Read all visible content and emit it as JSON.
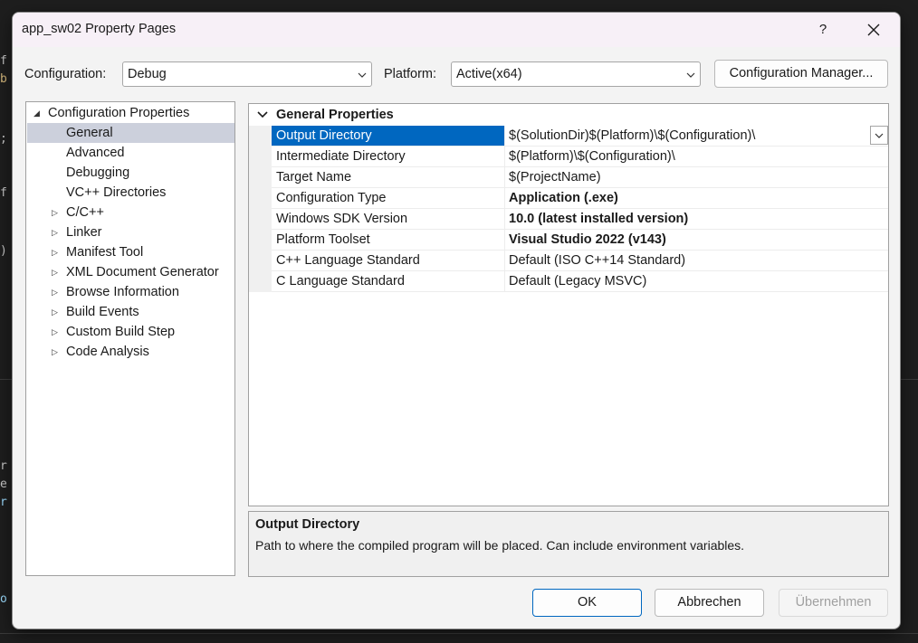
{
  "window": {
    "title": "app_sw02 Property Pages",
    "help_label": "?",
    "close_label": "✕"
  },
  "config_bar": {
    "configuration_label": "Configuration:",
    "configuration_value": "Debug",
    "platform_label": "Platform:",
    "platform_value": "Active(x64)",
    "manager_button": "Configuration Manager..."
  },
  "tree": {
    "root": "Configuration Properties",
    "children": [
      {
        "label": "General",
        "selected": true,
        "expandable": false
      },
      {
        "label": "Advanced",
        "expandable": false
      },
      {
        "label": "Debugging",
        "expandable": false
      },
      {
        "label": "VC++ Directories",
        "expandable": false
      },
      {
        "label": "C/C++",
        "expandable": true
      },
      {
        "label": "Linker",
        "expandable": true
      },
      {
        "label": "Manifest Tool",
        "expandable": true
      },
      {
        "label": "XML Document Generator",
        "expandable": true
      },
      {
        "label": "Browse Information",
        "expandable": true
      },
      {
        "label": "Build Events",
        "expandable": true
      },
      {
        "label": "Custom Build Step",
        "expandable": true
      },
      {
        "label": "Code Analysis",
        "expandable": true
      }
    ]
  },
  "grid": {
    "section": "General Properties",
    "rows": [
      {
        "name": "Output Directory",
        "value": "$(SolutionDir)$(Platform)\\$(Configuration)\\",
        "bold": false,
        "selected": true
      },
      {
        "name": "Intermediate Directory",
        "value": "$(Platform)\\$(Configuration)\\",
        "bold": false
      },
      {
        "name": "Target Name",
        "value": "$(ProjectName)",
        "bold": false
      },
      {
        "name": "Configuration Type",
        "value": "Application (.exe)",
        "bold": true
      },
      {
        "name": "Windows SDK Version",
        "value": "10.0 (latest installed version)",
        "bold": true
      },
      {
        "name": "Platform Toolset",
        "value": "Visual Studio 2022 (v143)",
        "bold": true
      },
      {
        "name": "C++ Language Standard",
        "value": "Default (ISO C++14 Standard)",
        "bold": false
      },
      {
        "name": "C Language Standard",
        "value": "Default (Legacy MSVC)",
        "bold": false
      }
    ]
  },
  "description": {
    "title": "Output Directory",
    "text": "Path to where the compiled program will be placed. Can include environment variables."
  },
  "buttons": {
    "ok": "OK",
    "cancel": "Abbrechen",
    "apply": "Übernehmen"
  },
  "colors": {
    "accent": "#0067c0",
    "tree_selection": "#ccd0dc"
  }
}
